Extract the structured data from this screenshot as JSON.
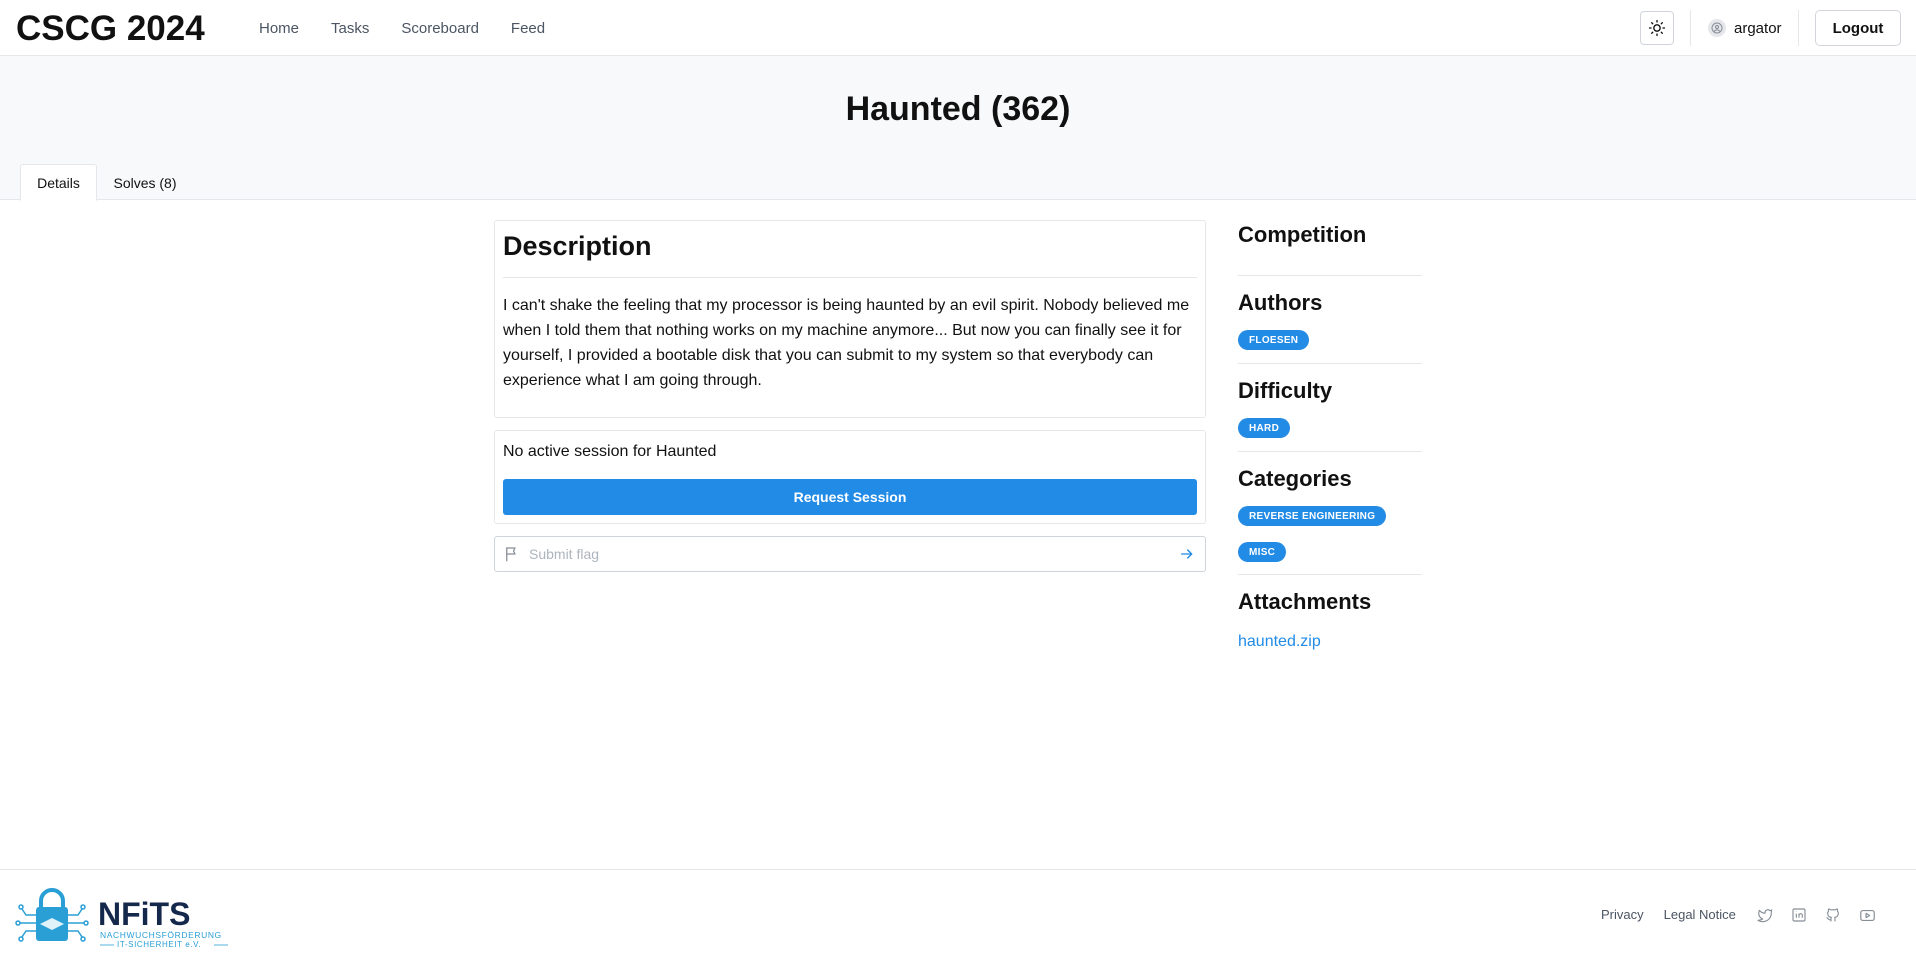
{
  "header": {
    "brand": "CSCG 2024",
    "nav": [
      "Home",
      "Tasks",
      "Scoreboard",
      "Feed"
    ],
    "username": "argator",
    "logout_label": "Logout",
    "theme_icon": "sun-icon",
    "user_icon": "user-circle-icon"
  },
  "task": {
    "title": "Haunted (362)",
    "tabs": [
      "Details",
      "Solves (8)"
    ],
    "active_tab": "Details"
  },
  "description": {
    "heading": "Description",
    "text": "I can't shake the feeling that my processor is being haunted by an evil spirit. Nobody believed me when I told them that nothing works on my machine anymore... But now you can finally see it for yourself, I provided a bootable disk that you can submit to my system so that everybody can experience what I am going through."
  },
  "session": {
    "status": "No active session for Haunted",
    "button_label": "Request Session"
  },
  "flag": {
    "placeholder": "Submit flag",
    "value": "",
    "icon": "flag-icon",
    "submit_icon": "arrow-right-icon"
  },
  "sidebar": {
    "competition_heading": "Competition",
    "authors_heading": "Authors",
    "authors": [
      "FLOESEN"
    ],
    "difficulty_heading": "Difficulty",
    "difficulty": "HARD",
    "categories_heading": "Categories",
    "categories": [
      "REVERSE ENGINEERING",
      "MISC"
    ],
    "attachments_heading": "Attachments",
    "attachments": [
      "haunted.zip"
    ]
  },
  "footer": {
    "logo_text": "NFiTS",
    "logo_sub1": "NACHWUCHSFÖRDERUNG",
    "logo_sub2": "IT-SICHERHEIT e.V.",
    "links": [
      "Privacy",
      "Legal Notice"
    ],
    "social_icons": [
      "twitter-icon",
      "linkedin-icon",
      "github-icon",
      "youtube-icon"
    ]
  },
  "colors": {
    "accent": "#228be6",
    "logo_dark": "#14284b",
    "logo_teal": "#2a9fd6",
    "hero_bg": "#f8f9fa",
    "border": "#e5e7eb"
  }
}
